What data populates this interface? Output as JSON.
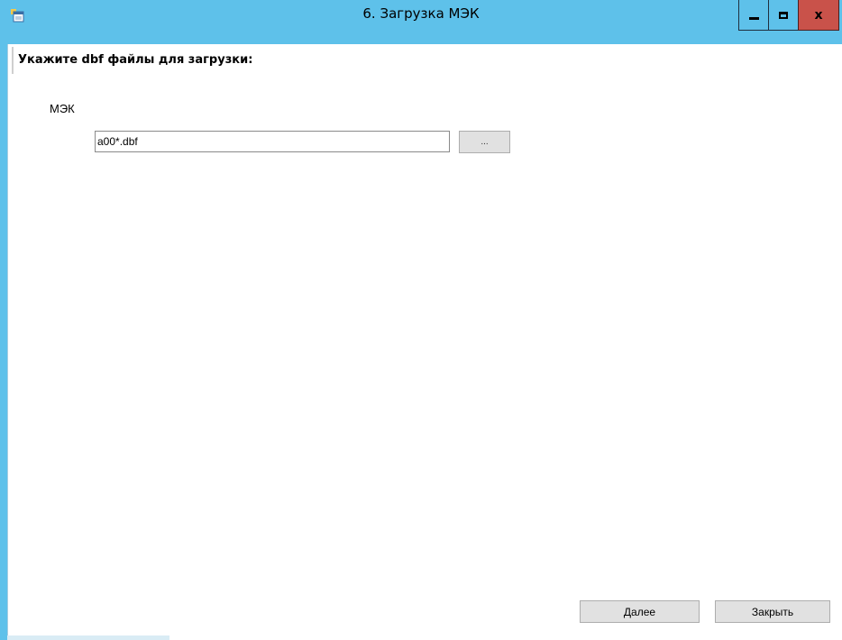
{
  "window": {
    "title": "6. Загрузка МЭК",
    "icon": "app-icon",
    "titlebar_color": "#5ec1ea",
    "close_color": "#c9524a"
  },
  "caption_buttons": {
    "minimize": "minimize-icon",
    "maximize": "maximize-icon",
    "close_label": "x"
  },
  "header": {
    "text": "Укажите dbf файлы для загрузки:"
  },
  "form": {
    "group_label": "МЭК",
    "file_input_value": "a00*.dbf",
    "browse_label": "..."
  },
  "footer": {
    "next_label": "Далее",
    "close_label": "Закрыть"
  }
}
